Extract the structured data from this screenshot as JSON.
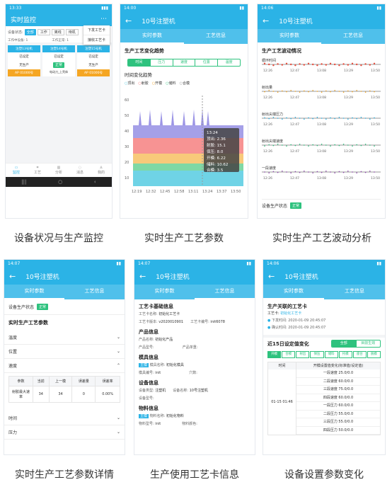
{
  "captions": [
    "设备状况与生产监控",
    "实时生产工艺参数",
    "实时生产工艺波动分析",
    "实时生产工艺参数详情",
    "生产使用工艺卡信息",
    "设备设置参数变化"
  ],
  "p1": {
    "time": "13:33",
    "title": "实时监控",
    "menu": [
      "下发工艺卡",
      "接收工艺卡"
    ],
    "filter_label": "设备状态:",
    "filters": [
      "全部",
      "工作",
      "离线",
      "待机"
    ],
    "row2": [
      "工作中设备: 1",
      "工作正常: 1",
      "工作异常: 0"
    ],
    "cards": [
      {
        "title": "注塑13号机",
        "status": "已设定",
        "proc": "无生产",
        "ap": "AP 01000号"
      },
      {
        "title": "注塑14号机",
        "status": "已设定",
        "proc": "正常",
        "ap": "电动刀_上壳体"
      },
      {
        "title": "注塑15号机",
        "status": "已设定",
        "proc": "无生产",
        "ap": "AP 01000号"
      }
    ],
    "bottom": [
      "监控",
      "工艺",
      "分析",
      "消息",
      "我的"
    ]
  },
  "p2": {
    "time": "14:00",
    "title": "10号注塑机",
    "tabs": [
      "实时参数",
      "工艺信息"
    ],
    "sec": "生产工艺变化趋势",
    "seg": [
      "时间",
      "压力",
      "速度",
      "位置",
      "温度"
    ],
    "chart_title": "时间变化趋势",
    "legend": [
      "顶出",
      "射胶",
      "开模",
      "储料",
      "合模"
    ],
    "tooltip": [
      "13:24",
      "顶出: 2.36",
      "射胶: 15.1",
      "保压: 8.0",
      "开模: 6.22",
      "储料: 10.62",
      "合模: 3.5"
    ],
    "yticks": [
      "60",
      "50",
      "40",
      "30",
      "20",
      "10"
    ],
    "xticks": [
      "12:19",
      "12:32",
      "12:45",
      "12:58",
      "13:11",
      "13:24",
      "13:37",
      "13:50"
    ]
  },
  "p3": {
    "time": "14:06",
    "title": "10号注塑机",
    "tabs": [
      "实时参数",
      "工艺信息"
    ],
    "sec": "生产工艺波动情况",
    "tracks": [
      "循环时间",
      "射出量",
      "射出尖端压力",
      "射出尖端速度",
      "一段速度"
    ],
    "xt": [
      "12:26",
      "12:47",
      "13:08",
      "13:29",
      "13:50"
    ],
    "status_label": "设备生产状态",
    "status": "正常"
  },
  "p4": {
    "time": "14:07",
    "title": "10号注塑机",
    "tabs": [
      "实时参数",
      "工艺信息"
    ],
    "status_label": "设备生产状态",
    "status": "正常",
    "sec": "实时生产工艺参数",
    "groups": [
      "温度",
      "位置",
      "速度"
    ],
    "headers": [
      "参数",
      "当前",
      "上一模",
      "误差量",
      "误差率"
    ],
    "row": [
      "射胶最大速率",
      "34",
      "34",
      "0",
      "0.00%"
    ],
    "more": [
      "时间",
      "压力"
    ]
  },
  "p5": {
    "time": "14:07",
    "title": "10号注塑机",
    "tabs": [
      "实时参数",
      "工艺信息"
    ],
    "s1": "工艺卡基础信息",
    "a": "工艺卡名称:",
    "av": "初始化工艺卡",
    "b": "工艺卡版本:",
    "bv": "v2020010901",
    "c": "工艺卡编号:",
    "cv": "init6078",
    "s2": "产品信息",
    "d": "产品名称:",
    "dv": "初始化产品",
    "e": "产品型号:",
    "f": "产品单重:",
    "s3": "模具信息",
    "tag": "主模",
    "g": "模具名称:",
    "gv": "初始化模具",
    "h": "模具编号:",
    "hv": "init",
    "i": "穴数:",
    "s4": "设备信息",
    "j": "设备类型:",
    "jv": "注塑机",
    "k": "设备名称:",
    "kv": "10号注塑机",
    "l": "设备型号:",
    "s5": "物料信息",
    "m": "物料名称:",
    "mv": "初始化物料",
    "n": "物料型号:",
    "nv": "init",
    "o": "物料颜色:"
  },
  "p6": {
    "time": "14:06",
    "title": "10号注塑机",
    "tabs": [
      "实时参数",
      "工艺信息"
    ],
    "sec": "生产关联的工艺卡",
    "card_label": "工艺卡:",
    "card": "初始化工艺卡",
    "t1": "下发时间: 2020-01-09 20:45:07",
    "t2": "确认时间: 2020-01-09 20:45:07",
    "sec2": "近15日设定值变化",
    "seg": [
      "全部",
      "目前生效"
    ],
    "seg2": [
      "开模",
      "合模",
      "射出",
      "保压",
      "储料",
      "托模",
      "座台",
      "脱模"
    ],
    "th": [
      "时间",
      "开模设置值变化(标准值/设定值)"
    ],
    "time_cell": "01-15 01:46",
    "vals": [
      "一段速度 25.0/0.0",
      "二段速度 60.0/0.0",
      "三段速度 75.0/0.0",
      "四段速度 60.0/0.0",
      "一段压力 60.0/0.0",
      "二段压力 55.0/0.0",
      "三段压力 55.0/0.0",
      "四段压力 50.0/0.0"
    ]
  }
}
